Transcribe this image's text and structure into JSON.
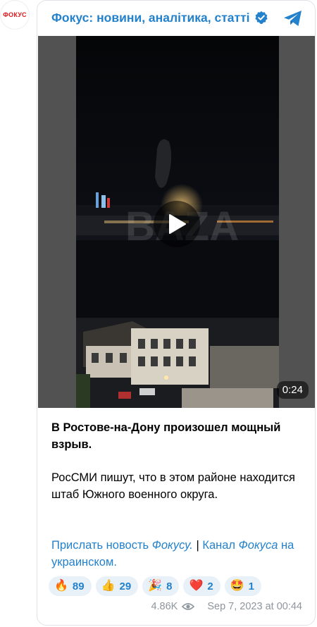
{
  "avatar": {
    "label": "ФОКУС"
  },
  "header": {
    "channel_title": "Фокус: новини, аналітика, статті"
  },
  "video": {
    "duration": "0:24",
    "watermark": "BAZA"
  },
  "post": {
    "headline": "В Ростове-на-Дону произошел мощный взрыв.",
    "body": "РосСМИ пишут, что в этом районе находится штаб Южного военного округа.",
    "footer": {
      "link1": "Прислать новость",
      "link1_em": "Фокусу.",
      "separator": " | ",
      "link2": "Канал",
      "link2_em": "Фокуса",
      "link2_tail": "на украинском."
    }
  },
  "reactions": [
    {
      "icon": "fire-icon",
      "emoji": "🔥",
      "count": "89"
    },
    {
      "icon": "thumbs-up-icon",
      "emoji": "👍",
      "count": "29"
    },
    {
      "icon": "party-popper-icon",
      "emoji": "🎉",
      "count": "8"
    },
    {
      "icon": "heart-icon",
      "emoji": "❤️",
      "count": "2"
    },
    {
      "icon": "star-struck-icon",
      "emoji": "🤩",
      "count": "1"
    }
  ],
  "meta": {
    "views": "4.86K",
    "date": "Sep 7, 2023 at 00:44"
  },
  "colors": {
    "accent": "#2481cc",
    "brand": "#e0171e",
    "muted": "#8d969c",
    "reaction_bg": "#e8f0f8"
  }
}
